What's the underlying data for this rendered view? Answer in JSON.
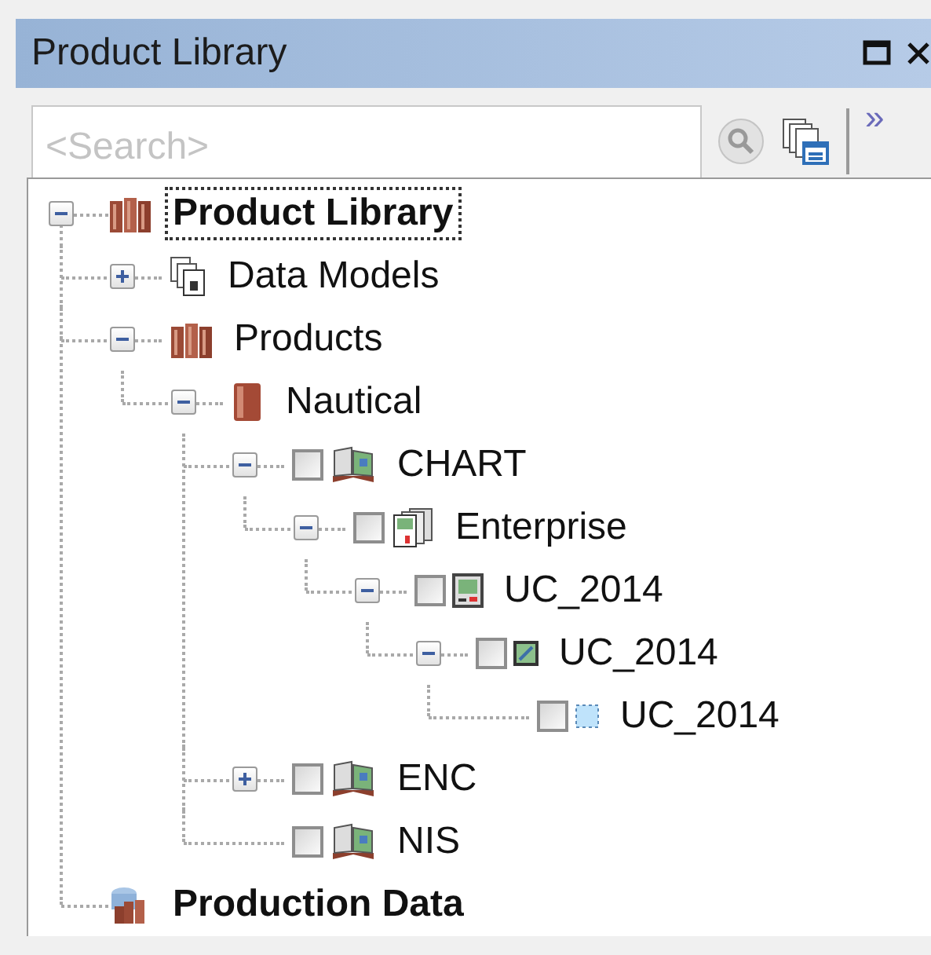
{
  "window": {
    "title": "Product Library"
  },
  "search": {
    "placeholder": "<Search>"
  },
  "toolbar": {
    "overflow": "»"
  },
  "tree": [
    {
      "label": "Product Library",
      "kind": "library",
      "bold": true,
      "focused": true,
      "expanded": true,
      "children": [
        {
          "label": "Data Models",
          "kind": "models",
          "expanded": false
        },
        {
          "label": "Products",
          "kind": "library",
          "expanded": true,
          "children": [
            {
              "label": "Nautical",
              "kind": "book",
              "expanded": true,
              "children": [
                {
                  "label": "CHART",
                  "kind": "atlas",
                  "checked": false,
                  "expanded": true,
                  "children": [
                    {
                      "label": "Enterprise",
                      "kind": "enterprise",
                      "checked": false,
                      "expanded": true,
                      "children": [
                        {
                          "label": "UC_2014",
                          "kind": "device",
                          "checked": false,
                          "expanded": true,
                          "children": [
                            {
                              "label": "UC_2014",
                              "kind": "map",
                              "checked": false,
                              "expanded": true,
                              "children": [
                                {
                                  "label": "UC_2014",
                                  "kind": "cell",
                                  "checked": false
                                }
                              ]
                            }
                          ]
                        }
                      ]
                    }
                  ]
                },
                {
                  "label": "ENC",
                  "kind": "atlas",
                  "checked": false,
                  "expanded": false
                },
                {
                  "label": "NIS",
                  "kind": "atlas",
                  "checked": false
                }
              ]
            }
          ]
        }
      ]
    },
    {
      "label": "Production Data",
      "kind": "production",
      "bold": true
    }
  ]
}
